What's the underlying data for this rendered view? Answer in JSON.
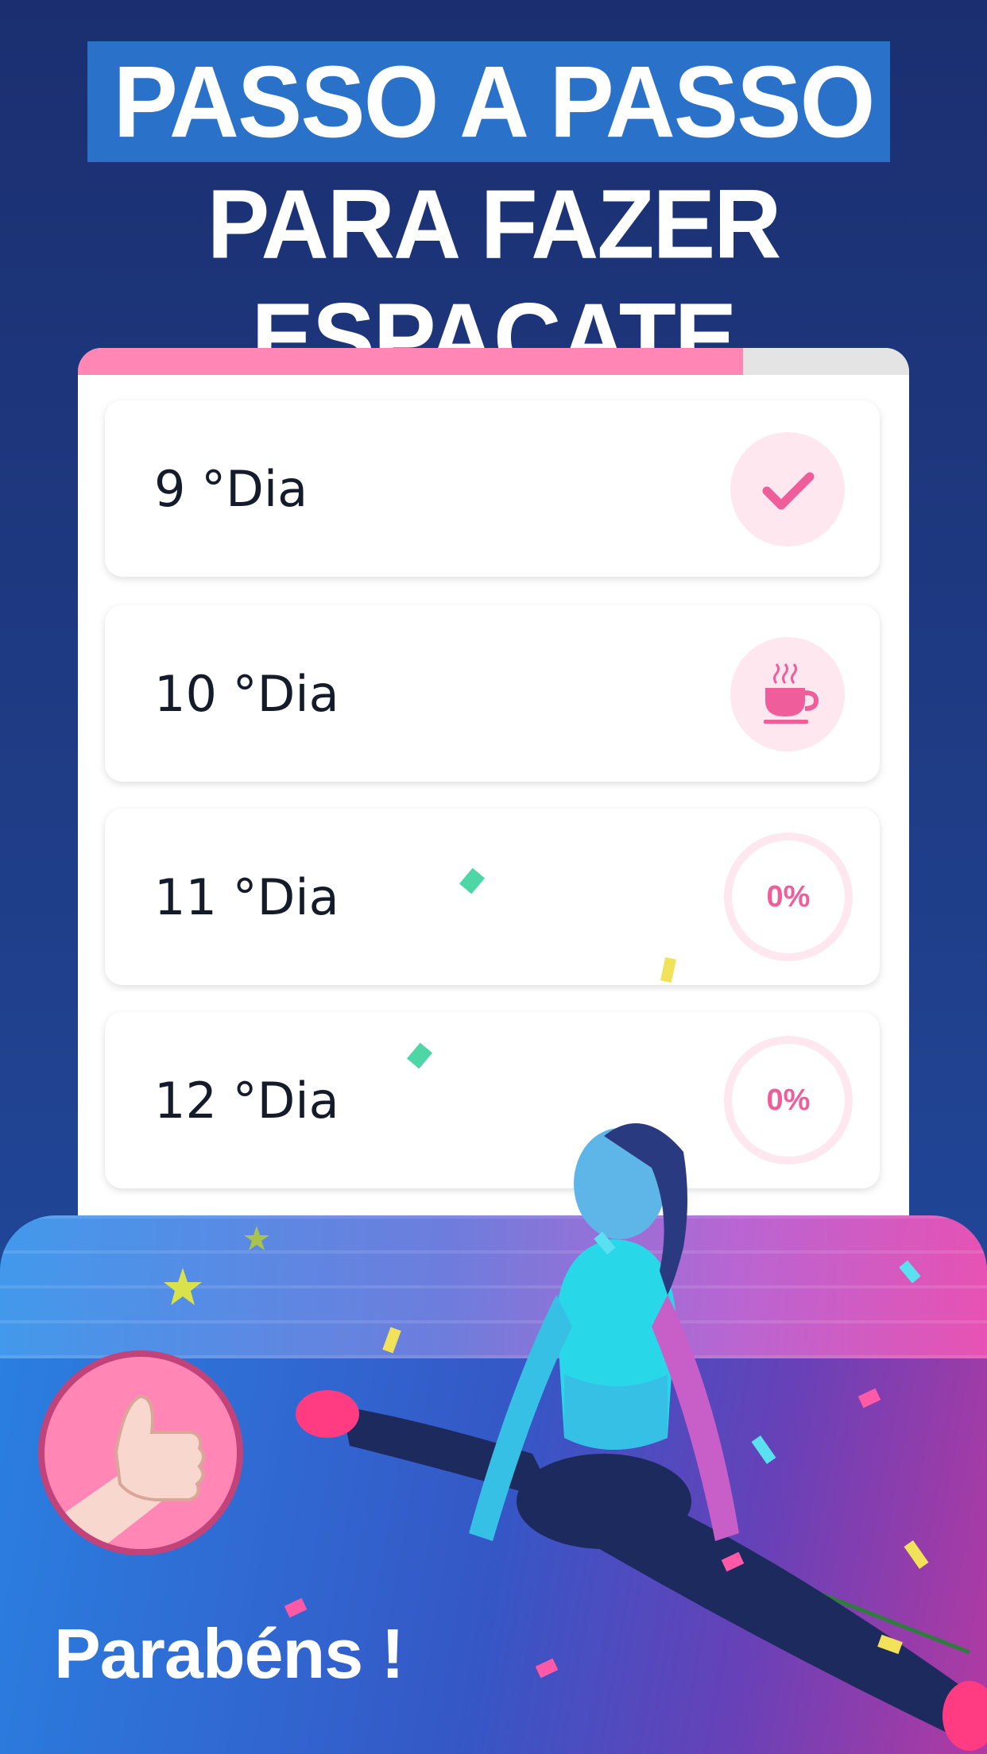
{
  "headline": {
    "line1": "PASSO A PASSO",
    "line2": "PARA FAZER ESPACATE"
  },
  "progress": {
    "fraction": 0.8
  },
  "days": [
    {
      "label": "9 °Dia",
      "status": "completed",
      "icon": "check-icon"
    },
    {
      "label": "10 °Dia",
      "status": "rest",
      "icon": "coffee-cup-icon"
    },
    {
      "label": "11 °Dia",
      "status": "progress",
      "percent": "0%"
    },
    {
      "label": "12 °Dia",
      "status": "progress",
      "percent": "0%"
    }
  ],
  "congrats": "Parabéns !",
  "colors": {
    "accent_pink": "#ff86b5",
    "text_dark": "#141c2c",
    "pale_pink": "#ffe7f0",
    "background_blue": "#1f3c86"
  }
}
